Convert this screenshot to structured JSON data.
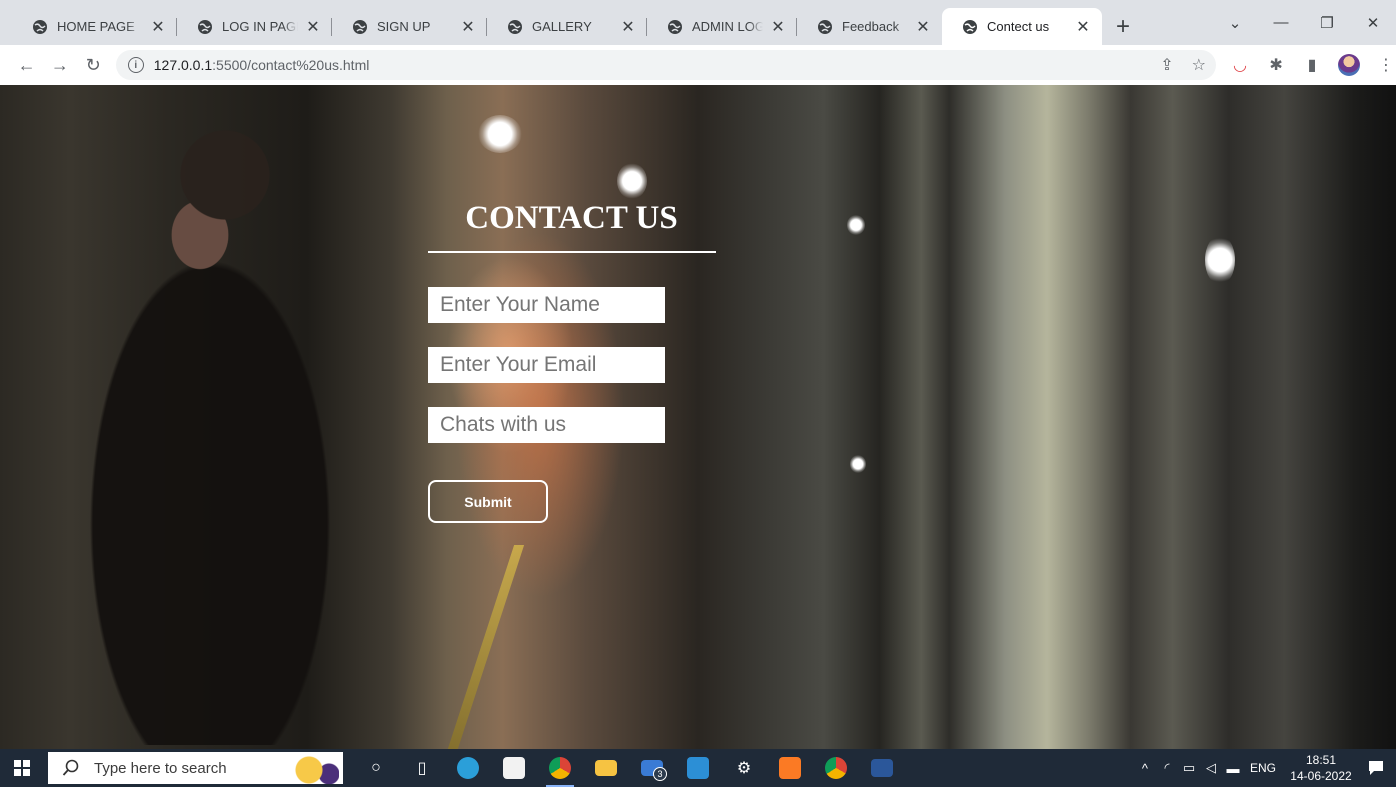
{
  "browser": {
    "tabs": [
      {
        "label": "HOME PAGE",
        "active": false
      },
      {
        "label": "LOG IN PAGE",
        "active": false
      },
      {
        "label": "SIGN UP",
        "active": false
      },
      {
        "label": "GALLERY",
        "active": false
      },
      {
        "label": "ADMIN LOG IN",
        "active": false
      },
      {
        "label": "Feedback",
        "active": false
      },
      {
        "label": "Contect us",
        "active": true
      }
    ],
    "new_tab_label": "+",
    "url_host": "127.0.0.1",
    "url_rest": ":5500/contact%20us.html"
  },
  "page": {
    "title": "CONTACT US",
    "name_placeholder": "Enter Your Name",
    "email_placeholder": "Enter Your Email",
    "chat_placeholder": "Chats with us",
    "submit_label": "Submit"
  },
  "taskbar": {
    "search_placeholder": "Type here to search",
    "mail_badge": "3",
    "language": "ENG",
    "time": "18:51",
    "date": "14-06-2022"
  },
  "colors": {
    "tabstrip": "#dee1e6",
    "taskbar": "#1f2a38",
    "form_text": "#ffffff"
  }
}
